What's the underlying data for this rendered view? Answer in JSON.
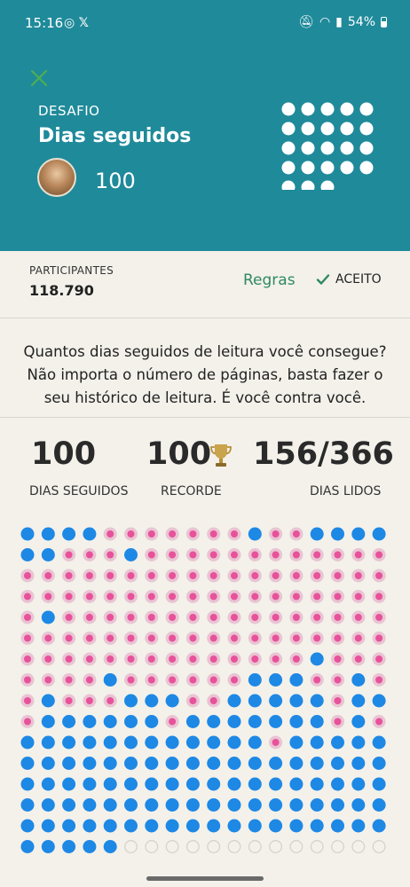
{
  "status_bar": {
    "time": "15:16",
    "icons_left": [
      "whatsapp-icon",
      "x-icon"
    ],
    "icons_right": [
      "mute-icon",
      "wifi-icon",
      "signal-icon"
    ],
    "battery": "54%"
  },
  "challenge": {
    "kicker": "DESAFIO",
    "title": "Dias seguidos",
    "user_count": "100",
    "header_dots": 23
  },
  "info": {
    "participants_label": "PARTICIPANTES",
    "participants_value": "118.790",
    "rules_label": "Regras",
    "accepted_label": "ACEITO"
  },
  "description": "Quantos dias seguidos de leitura você consegue? Não importa o número de páginas, basta fazer o seu histórico de leitura. É você contra você.",
  "stats": {
    "streak_value": "100",
    "streak_label": "DIAS SEGUIDOS",
    "record_value": "100",
    "record_label": "RECORDE",
    "days_read_value": "156/366",
    "days_read_label": "DIAS LIDOS"
  },
  "calendar": {
    "columns": 18,
    "rows": [
      "BBBBPPPPPPPBPPBBBB",
      "BBPPPBPPPPPPPPPPPP",
      "PPPPPPPPPPPPPPPPPP",
      "PPPPPPPPPPPPPPPPPP",
      "PBPPPPPPPPPPPPPPPP",
      "PPPPPPPPPPPPPPPPPP",
      "PPPPPPPPPPPPPPBPPP",
      "PPPPBPPPPPPBBBPPBP",
      "PBPPPBBBPPBBBBBPBB",
      "PBBBBBBPBBBBBBBPBP",
      "BBBBBBBBBBBBPBBBBB",
      "BBBBBBBBBBBBBBBBBB",
      "BBBBBBBBBBBBBBBBBB",
      "BBBBBBBBBBBBBBBBBB",
      "BBBBBBBBBBBBBBBBBB",
      "BBBBBEEEEEEEEEEEEE"
    ],
    "colors": {
      "read": "#1e88e5",
      "missed": "#e8529a",
      "missed_ring": "#e9c4d3",
      "future": "#d6d3cc"
    }
  },
  "colors": {
    "header_bg": "#1f8a9a",
    "accent_green": "#2f8a5e",
    "page_bg": "#f3f1ea"
  }
}
